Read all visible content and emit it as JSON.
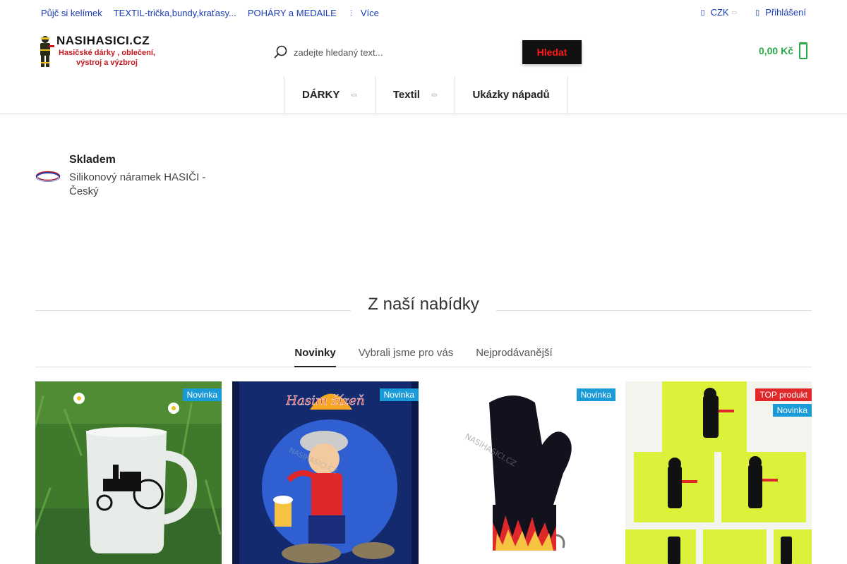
{
  "top_links": [
    "Půjč si kelímek",
    "TEXTIL-trička,bundy,kraťasy...",
    "POHÁRY a MEDAILE"
  ],
  "more_label": "Více",
  "currency": "CZK",
  "login_label": "Přihlášení",
  "logo": {
    "name": "NASIHASICI.CZ",
    "tagline_1": "Hasičské dárky , oblečení,",
    "tagline_2": "výstroj a výzbroj"
  },
  "search": {
    "placeholder": "zadejte hledaný text...",
    "button_label": "Hledat"
  },
  "cart_total": "0,00 Kč",
  "nav": [
    "DÁRKY",
    "Textil",
    "Ukázky nápadů"
  ],
  "stock_item": {
    "status": "Skladem",
    "name": "Silikonový náramek HASIČI - Český"
  },
  "section_title": "Z naší nabídky",
  "tabs": [
    "Novinky",
    "Vybrali jsme pro vás",
    "Nejprodávanější"
  ],
  "products": [
    {
      "badges": [
        "Novinka"
      ],
      "image": "frosted-mug-fire-pump"
    },
    {
      "badges": [
        "Novinka"
      ],
      "image": "hasim-zizen-towel"
    },
    {
      "badges": [
        "Novinka"
      ],
      "image": "oven-mitt-flames"
    },
    {
      "badges": [
        "TOP produkt",
        "Novinka"
      ],
      "image": "neon-yellow-mugs-firefighter"
    }
  ],
  "watermark": "NASIHASICI.CZ",
  "product_text": {
    "towel_title": "Hasim žízeň"
  },
  "colors": {
    "link": "#1a3cb4",
    "cart_green": "#2aa846",
    "search_btn_text": "#ff1a1a",
    "badge_blue": "#1a9bd8",
    "badge_red": "#e0282a"
  }
}
